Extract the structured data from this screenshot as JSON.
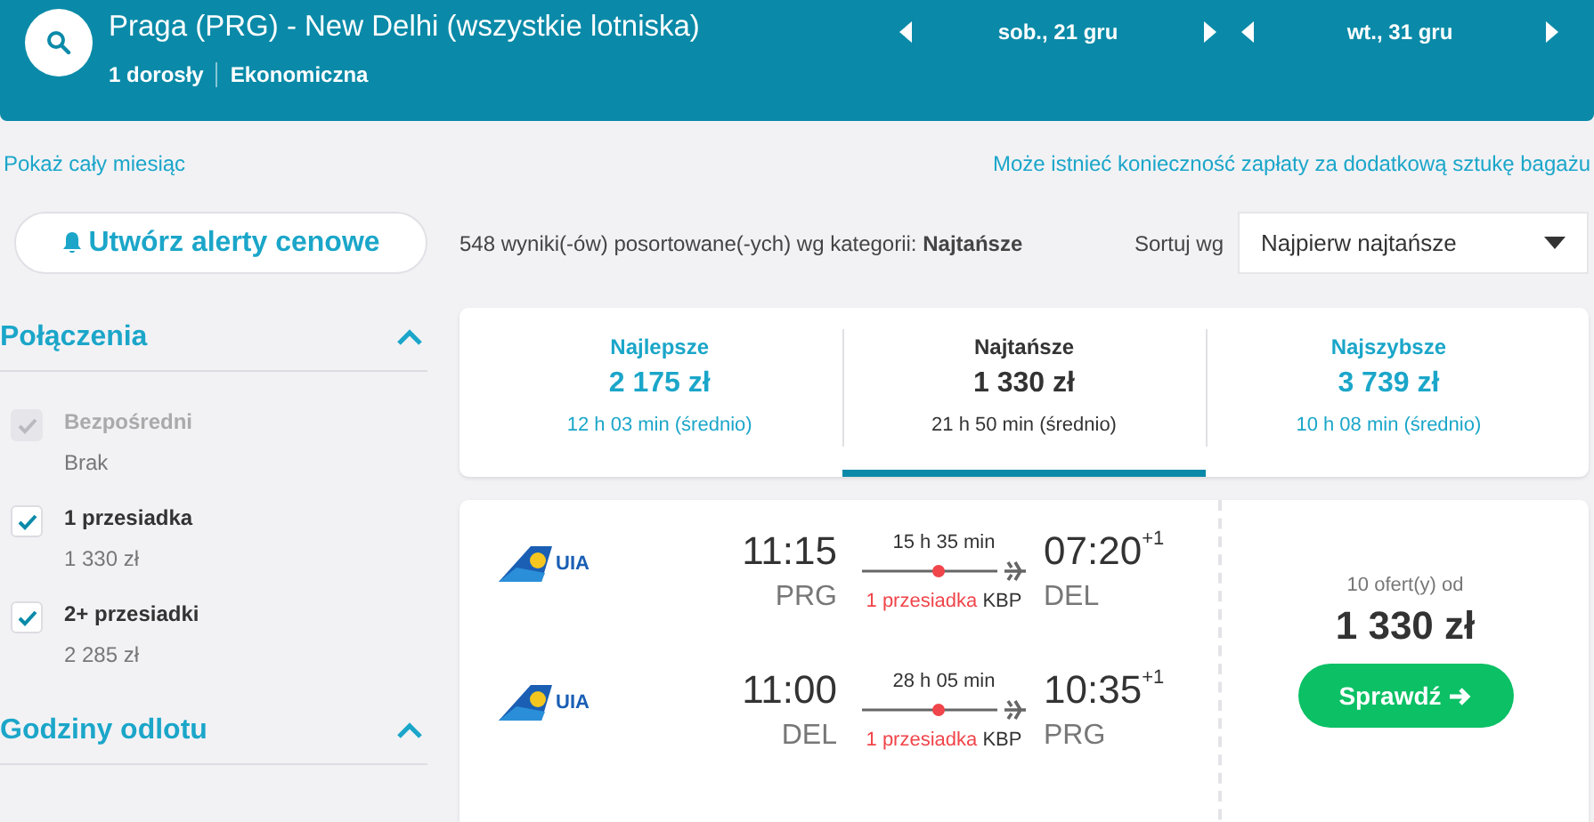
{
  "header": {
    "route": "Praga (PRG) - New Delhi (wszystkie lotniska)",
    "passengers": "1 dorosły",
    "cabin": "Ekonomiczna",
    "dates": [
      {
        "label": "sob., 21 gru"
      },
      {
        "label": "wt., 31 gru"
      }
    ]
  },
  "month_link": "Pokaż cały miesiąc",
  "baggage_note": "Może istnieć konieczność zapłaty za dodatkową sztukę bagażu",
  "alert_button": "Utwórz alerty cenowe",
  "results_summary": "548 wyniki(-ów) posortowane(-ych) wg kategorii: **Najtańsze**",
  "sort": {
    "label": "Sortuj wg",
    "value": "Najpierw najtańsze"
  },
  "filters": [
    {
      "title": "Połączenia",
      "expanded": true,
      "options": [
        {
          "label": "Bezpośredni",
          "sub": "Brak",
          "checked": true,
          "disabled": true
        },
        {
          "label": "1 przesiadka",
          "sub": "1 330 zł",
          "checked": true,
          "disabled": false
        },
        {
          "label": "2+ przesiadki",
          "sub": "2 285 zł",
          "checked": true,
          "disabled": false
        }
      ]
    },
    {
      "title": "Godziny odlotu",
      "expanded": true
    }
  ],
  "sort_tabs": [
    {
      "label": "Najlepsze",
      "price": "2 175 zł",
      "duration": "12 h 03 min (średnio)",
      "selected": false
    },
    {
      "label": "Najtańsze",
      "price": "1 330 zł",
      "duration": "21 h 50 min (średnio)",
      "selected": true
    },
    {
      "label": "Najszybsze",
      "price": "3 739 zł",
      "duration": "10 h 08 min (średnio)",
      "selected": false
    }
  ],
  "result": {
    "legs": [
      {
        "airline": "UIA",
        "depart_time": "11:15",
        "depart_airport": "PRG",
        "duration": "15 h 35 min",
        "stops": "1 przesiadka",
        "via": "KBP",
        "arrive_time": "07:20",
        "day_offset": "+1",
        "arrive_airport": "DEL"
      },
      {
        "airline": "UIA",
        "depart_time": "11:00",
        "depart_airport": "DEL",
        "duration": "28 h 05 min",
        "stops": "1 przesiadka",
        "via": "KBP",
        "arrive_time": "10:35",
        "day_offset": "+1",
        "arrive_airport": "PRG"
      }
    ],
    "offers": "10 ofert(y) od",
    "price": "1 330 zł",
    "button": "Sprawdź"
  }
}
